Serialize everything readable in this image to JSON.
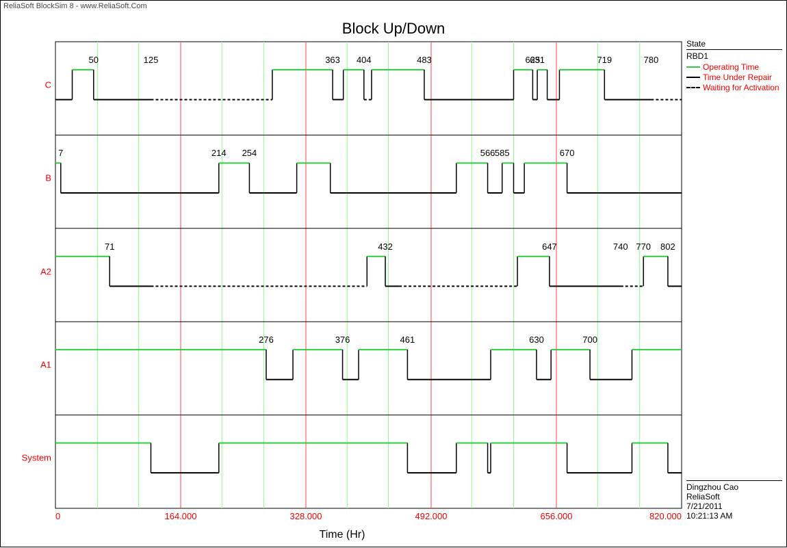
{
  "header": {
    "product": "ReliaSoft BlockSim 8 - www.ReliaSoft.Com"
  },
  "title": "Block Up/Down",
  "xlabel": "Time (Hr)",
  "legend": {
    "title": "State",
    "group": "RBD1",
    "items": [
      {
        "label": "Operating Time",
        "color": "#2ecc40",
        "dash": ""
      },
      {
        "label": "Time Under Repair",
        "color": "#000000",
        "dash": ""
      },
      {
        "label": "Waiting for Activation",
        "color": "#000000",
        "dash": "3,2"
      }
    ]
  },
  "meta": {
    "user": "Dingzhou Cao",
    "company": "ReliaSoft",
    "date": "7/21/2011",
    "time": "10:21:13 AM"
  },
  "axis": {
    "x_min": 0,
    "x_max": 820,
    "ticks": [
      0,
      164,
      328,
      492,
      656,
      820
    ],
    "tick_labels": [
      "0",
      "164.000",
      "328.000",
      "492.000",
      "656.000",
      "820.000"
    ]
  },
  "chart_data": {
    "type": "updown",
    "x_min": 0,
    "x_max": 820,
    "rows": [
      {
        "name": "C",
        "segments": [
          {
            "t0": 0,
            "t1": 22,
            "state": "down_repair"
          },
          {
            "t0": 22,
            "t1": 50,
            "state": "up",
            "label": 50
          },
          {
            "t0": 50,
            "t1": 125,
            "state": "down_repair",
            "label": 125
          },
          {
            "t0": 125,
            "t1": 284,
            "state": "down_wait"
          },
          {
            "t0": 284,
            "t1": 363,
            "state": "up",
            "label": 363
          },
          {
            "t0": 363,
            "t1": 377,
            "state": "down_repair"
          },
          {
            "t0": 377,
            "t1": 404,
            "state": "up",
            "label": 404
          },
          {
            "t0": 404,
            "t1": 414,
            "state": "down_wait"
          },
          {
            "t0": 414,
            "t1": 483,
            "state": "up",
            "label": 483
          },
          {
            "t0": 483,
            "t1": 600,
            "state": "down_repair"
          },
          {
            "t0": 600,
            "t1": 625,
            "state": "up",
            "label": 625
          },
          {
            "t0": 625,
            "t1": 631,
            "state": "down_repair",
            "label": 631
          },
          {
            "t0": 631,
            "t1": 644,
            "state": "up"
          },
          {
            "t0": 644,
            "t1": 660,
            "state": "down_repair"
          },
          {
            "t0": 660,
            "t1": 719,
            "state": "up",
            "label": 719
          },
          {
            "t0": 719,
            "t1": 780,
            "state": "down_repair",
            "label": 780
          },
          {
            "t0": 780,
            "t1": 820,
            "state": "down_wait"
          }
        ]
      },
      {
        "name": "B",
        "segments": [
          {
            "t0": 0,
            "t1": 7,
            "state": "up",
            "label": 7
          },
          {
            "t0": 7,
            "t1": 214,
            "state": "down_repair",
            "label": 214
          },
          {
            "t0": 214,
            "t1": 254,
            "state": "up",
            "label": 254
          },
          {
            "t0": 254,
            "t1": 316,
            "state": "down_repair"
          },
          {
            "t0": 316,
            "t1": 360,
            "state": "up"
          },
          {
            "t0": 360,
            "t1": 525,
            "state": "down_repair"
          },
          {
            "t0": 525,
            "t1": 566,
            "state": "up",
            "label": 566
          },
          {
            "t0": 566,
            "t1": 585,
            "state": "down_repair",
            "label": 585
          },
          {
            "t0": 585,
            "t1": 600,
            "state": "up"
          },
          {
            "t0": 600,
            "t1": 614,
            "state": "down_repair"
          },
          {
            "t0": 614,
            "t1": 670,
            "state": "up",
            "label": 670
          },
          {
            "t0": 670,
            "t1": 820,
            "state": "down_repair"
          }
        ]
      },
      {
        "name": "A2",
        "segments": [
          {
            "t0": 0,
            "t1": 71,
            "state": "up",
            "label": 71
          },
          {
            "t0": 71,
            "t1": 125,
            "state": "down_repair"
          },
          {
            "t0": 125,
            "t1": 408,
            "state": "down_wait"
          },
          {
            "t0": 408,
            "t1": 432,
            "state": "up",
            "label": 432
          },
          {
            "t0": 432,
            "t1": 450,
            "state": "down_repair"
          },
          {
            "t0": 450,
            "t1": 605,
            "state": "down_wait"
          },
          {
            "t0": 605,
            "t1": 647,
            "state": "up",
            "label": 647
          },
          {
            "t0": 647,
            "t1": 740,
            "state": "down_repair",
            "label": 740
          },
          {
            "t0": 740,
            "t1": 770,
            "state": "down_wait",
            "label": 770
          },
          {
            "t0": 770,
            "t1": 802,
            "state": "up",
            "label": 802
          },
          {
            "t0": 802,
            "t1": 820,
            "state": "down_repair"
          }
        ]
      },
      {
        "name": "A1",
        "segments": [
          {
            "t0": 0,
            "t1": 276,
            "state": "up",
            "label": 276
          },
          {
            "t0": 276,
            "t1": 311,
            "state": "down_repair"
          },
          {
            "t0": 311,
            "t1": 376,
            "state": "up",
            "label": 376
          },
          {
            "t0": 376,
            "t1": 397,
            "state": "down_repair"
          },
          {
            "t0": 397,
            "t1": 461,
            "state": "up",
            "label": 461
          },
          {
            "t0": 461,
            "t1": 570,
            "state": "down_repair"
          },
          {
            "t0": 570,
            "t1": 630,
            "state": "up",
            "label": 630
          },
          {
            "t0": 630,
            "t1": 649,
            "state": "down_repair"
          },
          {
            "t0": 649,
            "t1": 700,
            "state": "up",
            "label": 700
          },
          {
            "t0": 700,
            "t1": 755,
            "state": "down_repair"
          },
          {
            "t0": 755,
            "t1": 820,
            "state": "up"
          }
        ]
      },
      {
        "name": "System",
        "segments": [
          {
            "t0": 0,
            "t1": 125,
            "state": "up"
          },
          {
            "t0": 125,
            "t1": 214,
            "state": "down_repair"
          },
          {
            "t0": 214,
            "t1": 461,
            "state": "up"
          },
          {
            "t0": 461,
            "t1": 525,
            "state": "down_repair"
          },
          {
            "t0": 525,
            "t1": 566,
            "state": "up"
          },
          {
            "t0": 566,
            "t1": 570,
            "state": "down_repair"
          },
          {
            "t0": 570,
            "t1": 670,
            "state": "up"
          },
          {
            "t0": 670,
            "t1": 755,
            "state": "down_repair"
          },
          {
            "t0": 755,
            "t1": 802,
            "state": "up"
          },
          {
            "t0": 802,
            "t1": 820,
            "state": "down_repair"
          }
        ]
      }
    ]
  }
}
